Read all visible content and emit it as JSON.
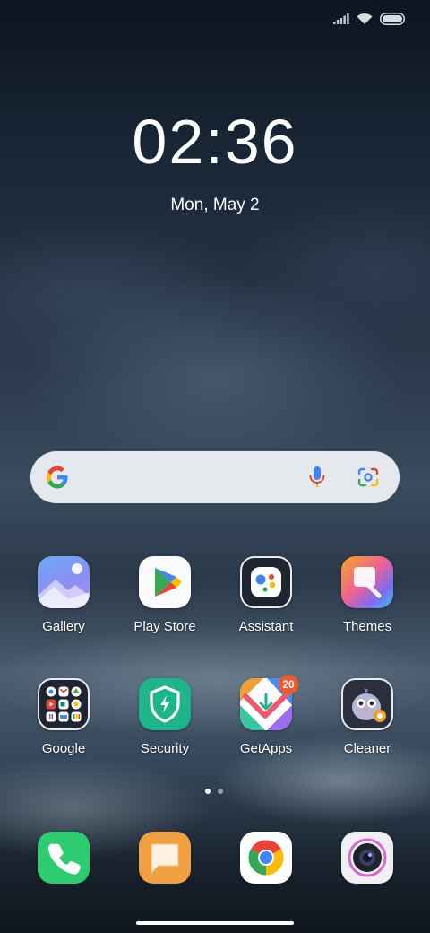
{
  "status_bar": {
    "signal_icon": "signal-icon",
    "wifi_icon": "wifi-icon",
    "battery_icon": "battery-icon"
  },
  "clock": {
    "time": "02:36",
    "date": "Mon, May 2"
  },
  "search_bar": {
    "logo_icon": "google-g-icon",
    "mic_icon": "mic-icon",
    "lens_icon": "lens-icon"
  },
  "apps": [
    {
      "label": "Gallery",
      "icon": "gallery-icon"
    },
    {
      "label": "Play Store",
      "icon": "play-store-icon"
    },
    {
      "label": "Assistant",
      "icon": "assistant-icon"
    },
    {
      "label": "Themes",
      "icon": "themes-icon"
    },
    {
      "label": "Google",
      "icon": "google-folder-icon"
    },
    {
      "label": "Security",
      "icon": "security-icon"
    },
    {
      "label": "GetApps",
      "icon": "getapps-icon",
      "badge": "20"
    },
    {
      "label": "Cleaner",
      "icon": "cleaner-icon"
    }
  ],
  "dock": [
    {
      "icon": "phone-icon"
    },
    {
      "icon": "messages-icon"
    },
    {
      "icon": "chrome-icon"
    },
    {
      "icon": "camera-icon"
    }
  ],
  "page_indicator": {
    "pages": 2,
    "current": 1
  },
  "colors": {
    "badge": "#f05a28",
    "security_green": "#1fb58a",
    "phone_green": "#2ecc71",
    "messages_orange": "#f0a040"
  }
}
